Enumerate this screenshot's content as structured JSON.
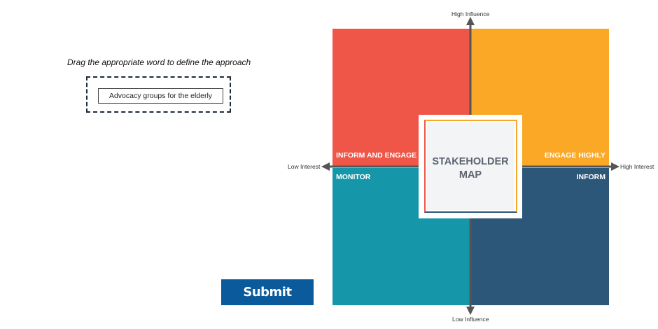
{
  "instruction": "Drag the appropriate word to define the approach",
  "drag_item": "Advocacy groups for the elderly",
  "submit_label": "Submit",
  "map": {
    "center_line1": "STAKEHOLDER",
    "center_line2": "MAP",
    "quadrants": {
      "top_left": "INFORM AND ENGAGE",
      "top_right": "ENGAGE HIGHLY",
      "bottom_left": "MONITOR",
      "bottom_right": "INFORM"
    },
    "axes": {
      "top": "High Influence",
      "bottom": "Low Influence",
      "left": "Low Interest",
      "right": "High Interest"
    }
  },
  "colors": {
    "top_left": "#ef5648",
    "top_right": "#fba827",
    "bottom_left": "#1697a9",
    "bottom_right": "#2d5778",
    "submit": "#0b5a9c"
  }
}
